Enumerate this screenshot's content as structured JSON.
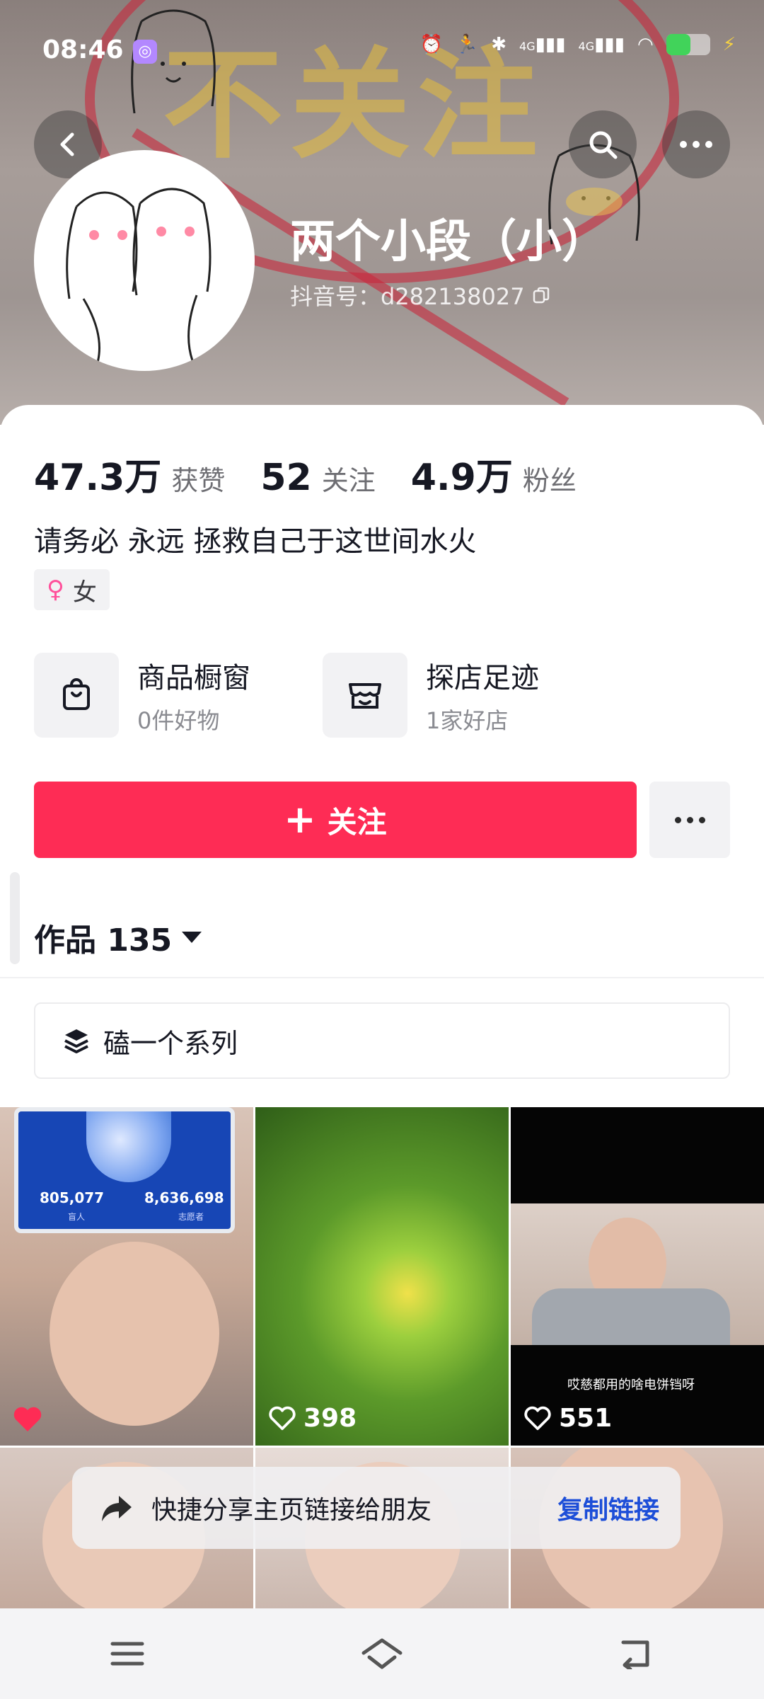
{
  "status_bar": {
    "time": "08:46",
    "network_1": "4G",
    "network_2": "4G",
    "battery_level": 0.55,
    "battery_color": "#41d35a"
  },
  "banner": {
    "watermark_text": "不关注"
  },
  "profile": {
    "nickname": "两个小段（小）",
    "douyin_id": "抖音号：d282138027"
  },
  "stats": [
    {
      "value": "47.3万",
      "label": "获赞"
    },
    {
      "value": "52",
      "label": "关注"
    },
    {
      "value": "4.9万",
      "label": "粉丝"
    }
  ],
  "bio": "请务必 永远 拯救自己于这世间水火",
  "gender_tag": {
    "icon": "female-icon",
    "label": "女"
  },
  "features": {
    "shop": {
      "title": "商品橱窗",
      "subtitle": "0件好物",
      "icon": "shopping-bag-icon"
    },
    "visit": {
      "title": "探店足迹",
      "subtitle": "1家好店",
      "icon": "store-icon"
    }
  },
  "actions": {
    "follow_label": "关注",
    "accent_color": "#fe2c55"
  },
  "works": {
    "label": "作品 135"
  },
  "series": {
    "label": "磕一个系列"
  },
  "grid": {
    "items": [
      {
        "likes": "",
        "liked": true,
        "overlay_numbers": [
          "805,077",
          "8,636,698"
        ],
        "overlay_labels": [
          "盲人",
          "志愿者"
        ]
      },
      {
        "likes": "398",
        "liked": false
      },
      {
        "likes": "551",
        "liked": false,
        "caption": "哎慈都用的啥电饼铛呀"
      },
      {
        "likes": ""
      },
      {
        "likes": ""
      },
      {
        "likes": ""
      }
    ]
  },
  "share_toast": {
    "text": "快捷分享主页链接给朋友",
    "action": "复制链接"
  }
}
